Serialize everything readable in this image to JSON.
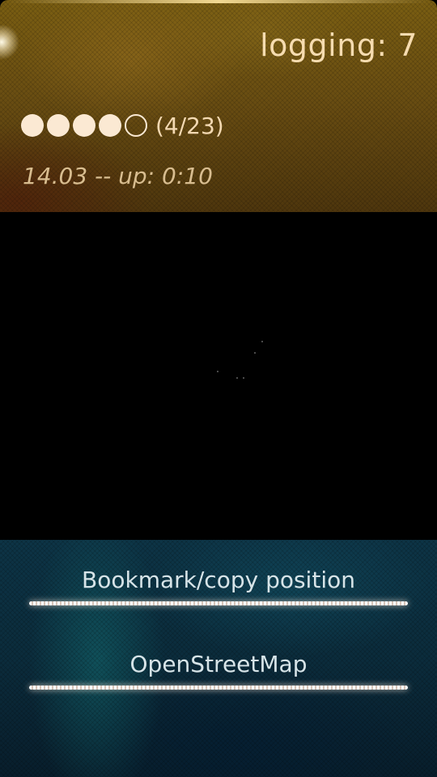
{
  "header": {
    "logging_label": "logging: 7",
    "satellites": {
      "dots": [
        {
          "state": "filled"
        },
        {
          "state": "filled"
        },
        {
          "state": "filled"
        },
        {
          "state": "filled"
        },
        {
          "state": "empty"
        }
      ],
      "count_text": "(4/23)"
    },
    "uptime_label": "14.03 -- up: 0:10"
  },
  "actions": {
    "bookmark_label": "Bookmark/copy position",
    "osm_label": "OpenStreetMap"
  },
  "colors": {
    "header_accent": "#f6dcb0",
    "footer_accent": "#0d3446"
  }
}
